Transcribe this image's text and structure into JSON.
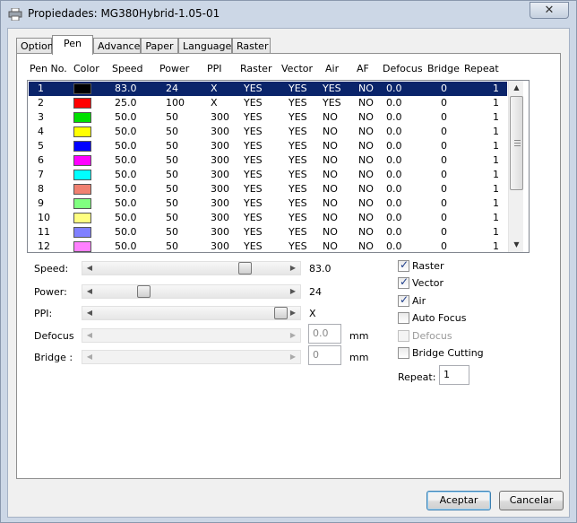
{
  "window": {
    "title": "Propiedades: MG380Hybrid-1.05-01"
  },
  "tabs": [
    "Option",
    "Pen",
    "Advance",
    "Paper",
    "Language",
    "Raster"
  ],
  "pen_list": {
    "headers": [
      "Pen No.",
      "Color",
      "Speed",
      "Power",
      "PPI",
      "Raster",
      "Vector",
      "Air",
      "AF",
      "Defocus",
      "Bridge",
      "Repeat"
    ],
    "rows": [
      {
        "no": "1",
        "color": "#000000",
        "speed": "83.0",
        "power": "24",
        "ppi": "X",
        "raster": "YES",
        "vector": "YES",
        "air": "YES",
        "af": "NO",
        "defocus": "0.0",
        "bridge": "0",
        "repeat": "1"
      },
      {
        "no": "2",
        "color": "#ff0000",
        "speed": "25.0",
        "power": "100",
        "ppi": "X",
        "raster": "YES",
        "vector": "YES",
        "air": "YES",
        "af": "NO",
        "defocus": "0.0",
        "bridge": "0",
        "repeat": "1"
      },
      {
        "no": "3",
        "color": "#00e000",
        "speed": "50.0",
        "power": "50",
        "ppi": "300",
        "raster": "YES",
        "vector": "YES",
        "air": "NO",
        "af": "NO",
        "defocus": "0.0",
        "bridge": "0",
        "repeat": "1"
      },
      {
        "no": "4",
        "color": "#ffff00",
        "speed": "50.0",
        "power": "50",
        "ppi": "300",
        "raster": "YES",
        "vector": "YES",
        "air": "NO",
        "af": "NO",
        "defocus": "0.0",
        "bridge": "0",
        "repeat": "1"
      },
      {
        "no": "5",
        "color": "#0000ff",
        "speed": "50.0",
        "power": "50",
        "ppi": "300",
        "raster": "YES",
        "vector": "YES",
        "air": "NO",
        "af": "NO",
        "defocus": "0.0",
        "bridge": "0",
        "repeat": "1"
      },
      {
        "no": "6",
        "color": "#ff00ff",
        "speed": "50.0",
        "power": "50",
        "ppi": "300",
        "raster": "YES",
        "vector": "YES",
        "air": "NO",
        "af": "NO",
        "defocus": "0.0",
        "bridge": "0",
        "repeat": "1"
      },
      {
        "no": "7",
        "color": "#00ffff",
        "speed": "50.0",
        "power": "50",
        "ppi": "300",
        "raster": "YES",
        "vector": "YES",
        "air": "NO",
        "af": "NO",
        "defocus": "0.0",
        "bridge": "0",
        "repeat": "1"
      },
      {
        "no": "8",
        "color": "#f08070",
        "speed": "50.0",
        "power": "50",
        "ppi": "300",
        "raster": "YES",
        "vector": "YES",
        "air": "NO",
        "af": "NO",
        "defocus": "0.0",
        "bridge": "0",
        "repeat": "1"
      },
      {
        "no": "9",
        "color": "#80ff80",
        "speed": "50.0",
        "power": "50",
        "ppi": "300",
        "raster": "YES",
        "vector": "YES",
        "air": "NO",
        "af": "NO",
        "defocus": "0.0",
        "bridge": "0",
        "repeat": "1"
      },
      {
        "no": "10",
        "color": "#ffff80",
        "speed": "50.0",
        "power": "50",
        "ppi": "300",
        "raster": "YES",
        "vector": "YES",
        "air": "NO",
        "af": "NO",
        "defocus": "0.0",
        "bridge": "0",
        "repeat": "1"
      },
      {
        "no": "11",
        "color": "#8080ff",
        "speed": "50.0",
        "power": "50",
        "ppi": "300",
        "raster": "YES",
        "vector": "YES",
        "air": "NO",
        "af": "NO",
        "defocus": "0.0",
        "bridge": "0",
        "repeat": "1"
      },
      {
        "no": "12",
        "color": "#ff80ff",
        "speed": "50.0",
        "power": "50",
        "ppi": "300",
        "raster": "YES",
        "vector": "YES",
        "air": "NO",
        "af": "NO",
        "defocus": "0.0",
        "bridge": "0",
        "repeat": "1"
      }
    ],
    "selected_index": 0
  },
  "controls": {
    "speed": {
      "label": "Speed:",
      "value": "83.0",
      "level": 0.8
    },
    "power": {
      "label": "Power:",
      "value": "24",
      "level": 0.24
    },
    "ppi": {
      "label": "PPI:",
      "value": "X",
      "level": 1.0
    },
    "defocus": {
      "label": "Defocus",
      "value": "0.0",
      "unit": "mm"
    },
    "bridge": {
      "label": "Bridge :",
      "value": "0",
      "unit": "mm"
    }
  },
  "options": {
    "raster": {
      "label": "Raster",
      "checked": true
    },
    "vector": {
      "label": "Vector",
      "checked": true
    },
    "air": {
      "label": "Air",
      "checked": true
    },
    "auto_focus": {
      "label": "Auto Focus",
      "checked": false
    },
    "defocus": {
      "label": "Defocus",
      "checked": false
    },
    "bridge_cutting": {
      "label": "Bridge Cutting",
      "checked": false
    },
    "repeat_label": "Repeat:",
    "repeat_value": "1"
  },
  "buttons": {
    "ok": "Aceptar",
    "cancel": "Cancelar"
  },
  "icons": {
    "title": "printer-icon",
    "close": "close-icon"
  }
}
